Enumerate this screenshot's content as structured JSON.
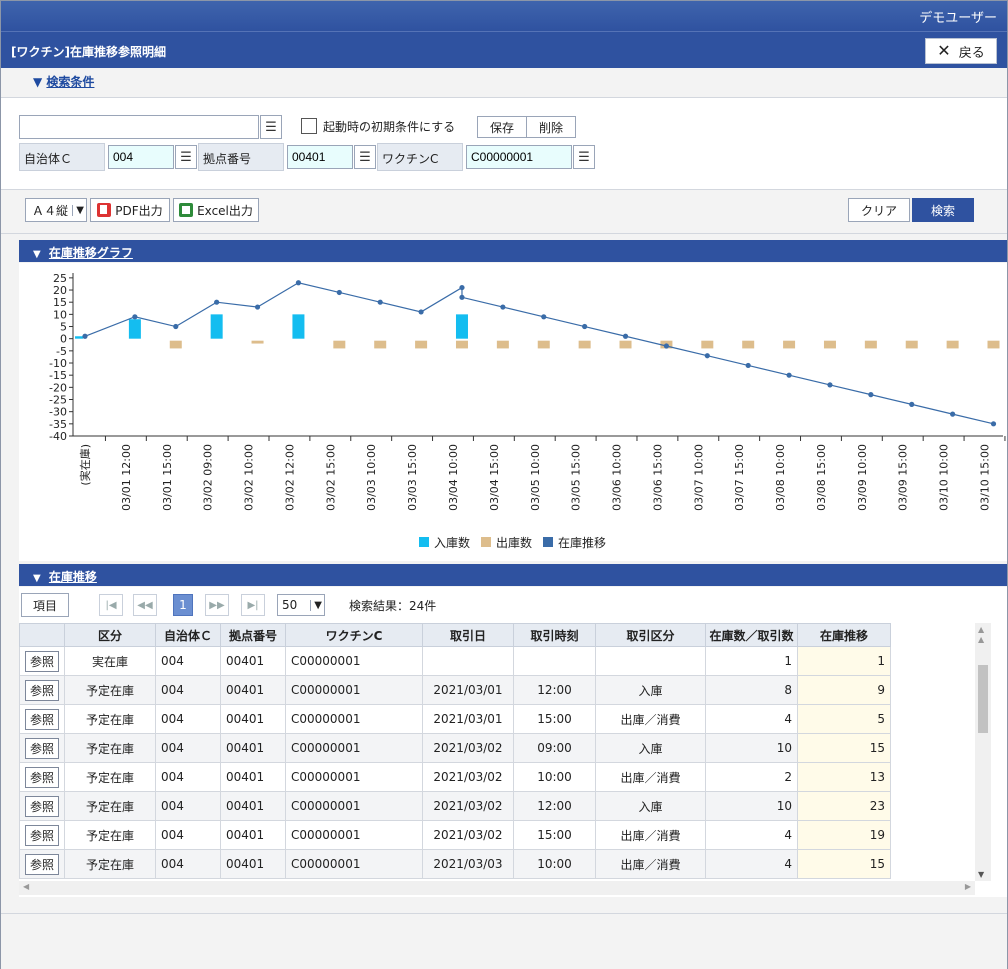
{
  "header": {
    "user": "デモユーザー",
    "title": "[ワクチン]在庫推移参照明細",
    "back_label": "戻る"
  },
  "conditions": {
    "section_label": "検索条件",
    "saved_condition_value": "",
    "startup_checkbox_label": "起動時の初期条件にする",
    "save_label": "保存",
    "delete_label": "削除",
    "fields": [
      {
        "label": "自治体Ｃ",
        "value": "004"
      },
      {
        "label": "拠点番号",
        "value": "00401"
      },
      {
        "label": "ワクチンC",
        "value": "C00000001"
      }
    ]
  },
  "toolbar": {
    "paper_size": "Ａ４縦",
    "pdf_label": "PDF出力",
    "excel_label": "Excel出力",
    "clear_label": "クリア",
    "search_label": "検索"
  },
  "graph_section": {
    "label": "在庫推移グラフ"
  },
  "chart_data": {
    "type": "bar",
    "categories": [
      "(実在庫)",
      "03/01 12:00",
      "03/01 15:00",
      "03/02 09:00",
      "03/02 10:00",
      "03/02 12:00",
      "03/02 15:00",
      "03/03 10:00",
      "03/03 15:00",
      "03/04 10:00",
      "03/04 15:00",
      "03/05 10:00",
      "03/05 15:00",
      "03/06 10:00",
      "03/06 15:00",
      "03/07 10:00",
      "03/07 15:00",
      "03/08 10:00",
      "03/08 15:00",
      "03/09 10:00",
      "03/09 15:00",
      "03/10 10:00",
      "03/10 15:00"
    ],
    "yticks": [
      25,
      20,
      15,
      10,
      5,
      0,
      -5,
      -10,
      -15,
      -20,
      -25,
      -30,
      -35,
      -40
    ],
    "ylim": [
      -40,
      27
    ],
    "colors": {
      "inbound": "#14bdf0",
      "outbound": "#ddbd8c",
      "trend": "#3a6ca8"
    },
    "series": [
      {
        "name": "入庫数",
        "type": "bar",
        "values": [
          1,
          8,
          0,
          10,
          0,
          10,
          0,
          0,
          0,
          10,
          0,
          0,
          0,
          0,
          0,
          0,
          0,
          0,
          0,
          0,
          0,
          0,
          0
        ]
      },
      {
        "name": "出庫数",
        "type": "bar",
        "values": [
          0,
          0,
          -4,
          0,
          -2,
          0,
          -4,
          -4,
          -4,
          -4,
          -4,
          -4,
          -4,
          -4,
          -4,
          -4,
          -4,
          -4,
          -4,
          -4,
          -4,
          -4,
          -4
        ]
      },
      {
        "name": "在庫推移",
        "type": "line",
        "points": [
          [
            0,
            1
          ],
          [
            1,
            9
          ],
          [
            2,
            5
          ],
          [
            3,
            15
          ],
          [
            4,
            13
          ],
          [
            5,
            23
          ],
          [
            6,
            19
          ],
          [
            7,
            15
          ],
          [
            8,
            11
          ],
          [
            9,
            21
          ],
          [
            9,
            17
          ],
          [
            10,
            13
          ],
          [
            11,
            9
          ],
          [
            12,
            5
          ],
          [
            13,
            1
          ],
          [
            14,
            -3
          ],
          [
            15,
            -7
          ],
          [
            16,
            -11
          ],
          [
            17,
            -15
          ],
          [
            18,
            -19
          ],
          [
            19,
            -23
          ],
          [
            20,
            -27
          ],
          [
            21,
            -31
          ],
          [
            22,
            -35
          ]
        ]
      }
    ]
  },
  "grid_section": {
    "label": "在庫推移",
    "columns_button": "項目",
    "current_page": "1",
    "page_size": "50",
    "result_text": "検索結果：24件",
    "ref_label": "参照",
    "headers": [
      "",
      "区分",
      "自治体Ｃ",
      "拠点番号",
      "ワクチンC",
      "取引日",
      "取引時刻",
      "取引区分",
      "在庫数／取引数",
      "在庫推移"
    ],
    "rows": [
      [
        "実在庫",
        "004",
        "00401",
        "C00000001",
        "",
        "",
        "",
        "1",
        "1"
      ],
      [
        "予定在庫",
        "004",
        "00401",
        "C00000001",
        "2021/03/01",
        "12:00",
        "入庫",
        "8",
        "9"
      ],
      [
        "予定在庫",
        "004",
        "00401",
        "C00000001",
        "2021/03/01",
        "15:00",
        "出庫／消費",
        "4",
        "5"
      ],
      [
        "予定在庫",
        "004",
        "00401",
        "C00000001",
        "2021/03/02",
        "09:00",
        "入庫",
        "10",
        "15"
      ],
      [
        "予定在庫",
        "004",
        "00401",
        "C00000001",
        "2021/03/02",
        "10:00",
        "出庫／消費",
        "2",
        "13"
      ],
      [
        "予定在庫",
        "004",
        "00401",
        "C00000001",
        "2021/03/02",
        "12:00",
        "入庫",
        "10",
        "23"
      ],
      [
        "予定在庫",
        "004",
        "00401",
        "C00000001",
        "2021/03/02",
        "15:00",
        "出庫／消費",
        "4",
        "19"
      ],
      [
        "予定在庫",
        "004",
        "00401",
        "C00000001",
        "2021/03/03",
        "10:00",
        "出庫／消費",
        "4",
        "15"
      ]
    ]
  }
}
